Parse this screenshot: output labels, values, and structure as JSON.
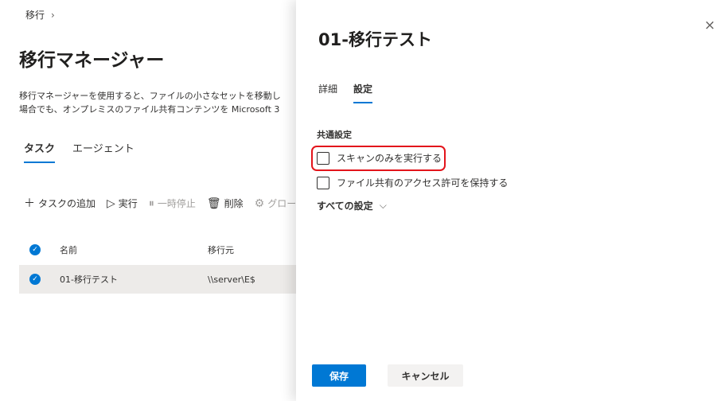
{
  "breadcrumb": {
    "label": "移行",
    "chevron": "›"
  },
  "page": {
    "title": "移行マネージャー",
    "description_line1": "移行マネージャーを使用すると、ファイルの小さなセットを移動し",
    "description_line2": "場合でも、オンプレミスのファイル共有コンテンツを Microsoft 3"
  },
  "bg_tabs": [
    {
      "label": "タスク",
      "active": true
    },
    {
      "label": "エージェント",
      "active": false
    }
  ],
  "toolbar": {
    "add_task": "タスクの追加",
    "run": "実行",
    "pause": "一時停止",
    "delete": "削除",
    "global": "グロー"
  },
  "table": {
    "headers": {
      "name": "名前",
      "source": "移行元"
    },
    "rows": [
      {
        "name": "01-移行テスト",
        "source": "\\\\server\\E$"
      }
    ]
  },
  "panel": {
    "title": "01-移行テスト",
    "close": "×",
    "tabs": [
      {
        "label": "詳細",
        "active": false
      },
      {
        "label": "設定",
        "active": true
      }
    ],
    "section_title": "共通設定",
    "options": [
      {
        "label": "スキャンのみを実行する",
        "checked": false
      },
      {
        "label": "ファイル共有のアクセス許可を保持する",
        "checked": false
      }
    ],
    "all_settings": "すべての設定",
    "save": "保存",
    "cancel": "キャンセル"
  },
  "colors": {
    "accent": "#0078d4",
    "highlight": "#e3141b"
  }
}
